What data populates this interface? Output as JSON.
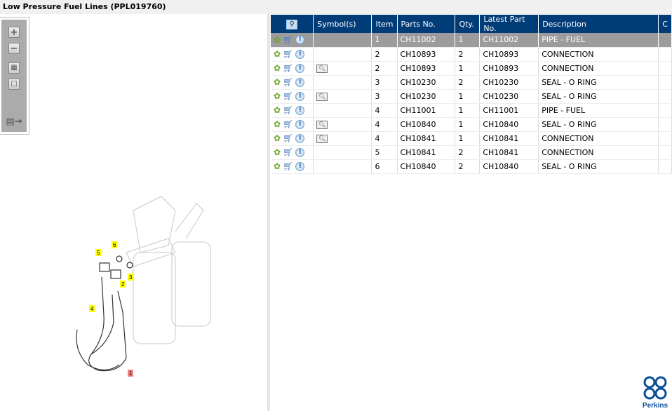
{
  "title": "Low Pressure Fuel Lines (PPL019760)",
  "toolbar": {
    "icons": [
      "zoom-in",
      "zoom-out",
      "fit-all",
      "fit-window",
      "toggle-panel"
    ]
  },
  "table": {
    "headers": {
      "search": "search-icon",
      "symbols": "Symbol(s)",
      "item": "Item",
      "part": "Parts No.",
      "qty": "Qty.",
      "latest": "Latest Part No.",
      "desc": "Description",
      "c": "C"
    },
    "rows": [
      {
        "symbol": false,
        "item": "1",
        "part": "CH11002",
        "qty": "1",
        "latest": "CH11002",
        "desc": "PIPE - FUEL",
        "selected": true
      },
      {
        "symbol": false,
        "item": "2",
        "part": "CH10893",
        "qty": "2",
        "latest": "CH10893",
        "desc": "CONNECTION"
      },
      {
        "symbol": true,
        "item": "2",
        "part": "CH10893",
        "qty": "1",
        "latest": "CH10893",
        "desc": "CONNECTION"
      },
      {
        "symbol": false,
        "item": "3",
        "part": "CH10230",
        "qty": "2",
        "latest": "CH10230",
        "desc": "SEAL - O RING"
      },
      {
        "symbol": true,
        "item": "3",
        "part": "CH10230",
        "qty": "1",
        "latest": "CH10230",
        "desc": "SEAL - O RING"
      },
      {
        "symbol": false,
        "item": "4",
        "part": "CH11001",
        "qty": "1",
        "latest": "CH11001",
        "desc": "PIPE - FUEL"
      },
      {
        "symbol": true,
        "item": "4",
        "part": "CH10840",
        "qty": "1",
        "latest": "CH10840",
        "desc": "SEAL - O RING"
      },
      {
        "symbol": true,
        "item": "4",
        "part": "CH10841",
        "qty": "1",
        "latest": "CH10841",
        "desc": "CONNECTION"
      },
      {
        "symbol": false,
        "item": "5",
        "part": "CH10841",
        "qty": "2",
        "latest": "CH10841",
        "desc": "CONNECTION"
      },
      {
        "symbol": false,
        "item": "6",
        "part": "CH10840",
        "qty": "2",
        "latest": "CH10840",
        "desc": "SEAL - O RING"
      }
    ]
  },
  "diagram": {
    "callouts": [
      "1",
      "2",
      "3",
      "4",
      "5",
      "6"
    ]
  },
  "logo": {
    "name": "Perkins"
  },
  "colors": {
    "header": "#003c78",
    "selected": "#9c9c9c",
    "callout": "#ffff00",
    "callout_selected": "#f08080"
  }
}
